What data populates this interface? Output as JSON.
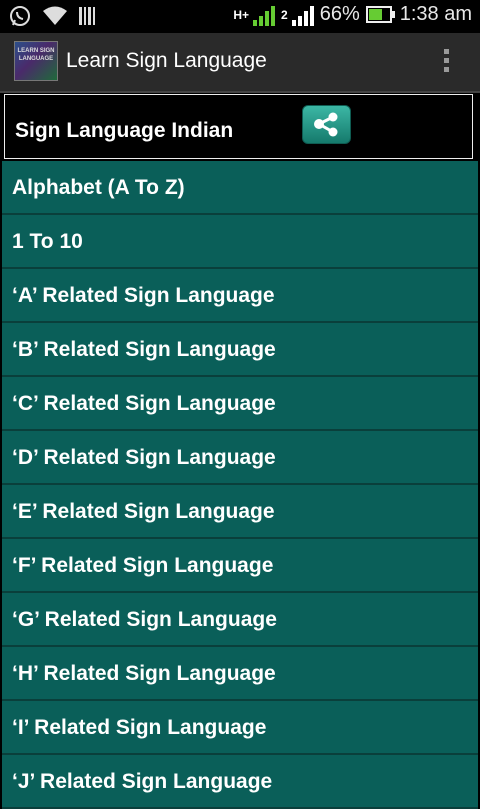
{
  "status_bar": {
    "battery": "66%",
    "time": "1:38 am",
    "net_type": "H+",
    "sim2": "2",
    "battery_level": 0.66
  },
  "action_bar": {
    "logo_text": "LEARN SIGN LANGUAGE",
    "title": "Learn Sign Language"
  },
  "header": {
    "title": "Sign Language Indian"
  },
  "list": [
    "Alphabet (A To Z)",
    "1 To 10",
    "‘A’ Related Sign Language",
    "‘B’ Related Sign Language",
    "‘C’ Related Sign Language",
    "‘D’ Related Sign Language",
    "‘E’ Related Sign Language",
    "‘F’ Related Sign Language",
    "‘G’ Related Sign Language",
    "‘H’ Related Sign Language",
    "‘I’ Related Sign Language",
    "‘J’ Related Sign Language"
  ],
  "colors": {
    "list_bg": "#0a5f59",
    "share_green": "#2aa08f"
  }
}
